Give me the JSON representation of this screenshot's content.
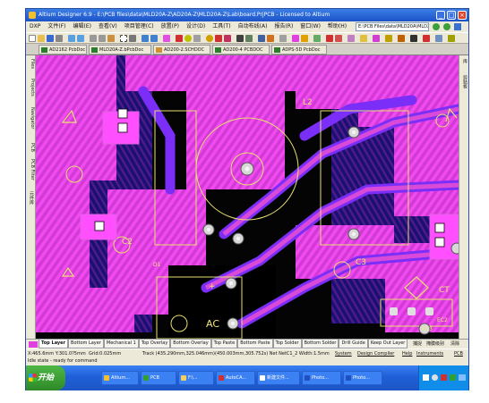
{
  "window": {
    "title": "Altium Designer 6.9 - E:\\PCB files\\data\\MLD20A-Z\\AD20A-Z\\MLD20A-Z\\Lab\\board.PrjPCB - Licensed to Altium",
    "min": "_",
    "max": "□",
    "close": "×"
  },
  "menu": [
    "DXP",
    "文件(F)",
    "编辑(E)",
    "查看(V)",
    "项目管理(C)",
    "放置(P)",
    "设计(D)",
    "工具(T)",
    "自动布线(A)",
    "报告(R)",
    "窗口(W)",
    "帮助(H)"
  ],
  "path_field": "E:\\PCB Files\\data\\MLD20A\\MLD20A-Z",
  "doc_tabs": [
    "AD2162 PcbDoc",
    "MLD20A-Z.bPcbDoc",
    "AD200-2.SCHDOC",
    "AD200-4 PCBDOC",
    "ADPS-5D PcbDoc"
  ],
  "left_panel_tabs": [
    "Files",
    "Projects",
    "Navigator",
    "PCB",
    "PCB Filter",
    "元件库"
  ],
  "right_panel_tabs": [
    "库",
    "剪贴板"
  ],
  "board_labels": {
    "L2": "L2",
    "C2": "C2",
    "C3": "C3",
    "AC": "AC",
    "CT": "CT",
    "D1": "D1",
    "plus": "+",
    "EC2": "EC2",
    "EC3": "EC3"
  },
  "layer_tabs": [
    "Top Layer",
    "Bottom Layer",
    "Mechanical 1",
    "Top Overlay",
    "Bottom Overlay",
    "Top Paste",
    "Bottom Paste",
    "Top Solder",
    "Bottom Solder",
    "Drill Guide",
    "Keep Out Layer"
  ],
  "layer_colors": [
    "#cc2020",
    "#2040e0",
    "#e040e0",
    "#ffff00",
    "#c0a000",
    "#808080",
    "#800000",
    "#800080",
    "#a0a000",
    "#c00000",
    "#ff00ff"
  ],
  "layerbar_right": [
    "捕捉",
    "掩膜级别",
    "清除"
  ],
  "status": {
    "coords": "X:465.6mm Y:301.0?5mm",
    "grid": "Grid:0.025mm",
    "track": "Track (435.290mm,325.046mm)(450.003mm,305.752s) Net NetC1_2 Width:1.5mm Length:31",
    "right_items": [
      "System",
      "Design Compiler",
      "Help",
      "Instruments",
      "PCB"
    ]
  },
  "status2": "Idle state - ready for command",
  "taskbar": {
    "start": "开始",
    "tasks": [
      "Altium...",
      "PCB",
      "F:\\...",
      "AutoCA...",
      "新建文件...",
      "Photo...",
      "Photo..."
    ]
  }
}
